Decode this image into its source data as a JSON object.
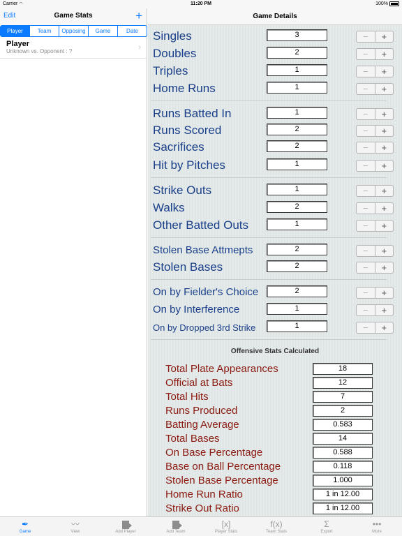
{
  "status": {
    "carrier": "Carrier",
    "time": "11:20 PM",
    "battery": "100%"
  },
  "left": {
    "edit_label": "Edit",
    "title": "Game Stats",
    "segments": [
      "Player",
      "Team",
      "Opposing",
      "Game",
      "Date"
    ],
    "active_segment": "Player",
    "player": {
      "name": "Player",
      "detail": "Unknown vs. Opponent : ?"
    }
  },
  "right": {
    "title": "Game Details",
    "stats": [
      {
        "label": "Singles",
        "value": "3"
      },
      {
        "label": "Doubles",
        "value": "2"
      },
      {
        "label": "Triples",
        "value": "1"
      },
      {
        "label": "Home Runs",
        "value": "1"
      },
      {
        "label": "Runs Batted In",
        "value": "1"
      },
      {
        "label": "Runs Scored",
        "value": "2"
      },
      {
        "label": "Sacrifices",
        "value": "2"
      },
      {
        "label": "Hit by Pitches",
        "value": "1"
      },
      {
        "label": "Strike Outs",
        "value": "1"
      },
      {
        "label": "Walks",
        "value": "2"
      },
      {
        "label": "Other Batted Outs",
        "value": "1"
      },
      {
        "label": "Stolen Base Attmepts",
        "value": "2"
      },
      {
        "label": "Stolen Bases",
        "value": "2"
      },
      {
        "label": "On by Fielder's Choice",
        "value": "2"
      },
      {
        "label": "On by Interference",
        "value": "1"
      },
      {
        "label": "On by Dropped 3rd Strike",
        "value": "1"
      }
    ],
    "stepper": {
      "minus": "−",
      "plus": "+"
    },
    "calc_title": "Offensive Stats Calculated",
    "calculated": [
      {
        "label": "Total Plate Appearances",
        "value": "18"
      },
      {
        "label": "Official at Bats",
        "value": "12"
      },
      {
        "label": "Total Hits",
        "value": "7"
      },
      {
        "label": "Runs Produced",
        "value": "2"
      },
      {
        "label": "Batting Average",
        "value": "0.583"
      },
      {
        "label": "Total Bases",
        "value": "14"
      },
      {
        "label": "On Base Percentage",
        "value": "0.588"
      },
      {
        "label": "Base on Ball Percentage",
        "value": "0.118"
      },
      {
        "label": "Stolen Base Percentage",
        "value": "1.000"
      },
      {
        "label": "Home Run Ratio",
        "value": "1 in 12.00"
      },
      {
        "label": "Strike Out Ratio",
        "value": "1 in 12.00"
      }
    ]
  },
  "tabs": [
    {
      "label": "Game",
      "icon": "feather-icon",
      "glyph": "✒"
    },
    {
      "label": "View",
      "icon": "signature-icon",
      "glyph": "〰"
    },
    {
      "label": "Add Player",
      "icon": "add-player-icon",
      "glyph": ""
    },
    {
      "label": "Add Team",
      "icon": "add-team-icon",
      "glyph": ""
    },
    {
      "label": "Player Stats",
      "icon": "bracket-x-icon",
      "glyph": "[x]"
    },
    {
      "label": "Team Stats",
      "icon": "fx-icon",
      "glyph": "f(x)"
    },
    {
      "label": "Export",
      "icon": "sigma-icon",
      "glyph": "Σ"
    },
    {
      "label": "More",
      "icon": "more-icon",
      "glyph": "•••"
    }
  ],
  "active_tab": "Game"
}
